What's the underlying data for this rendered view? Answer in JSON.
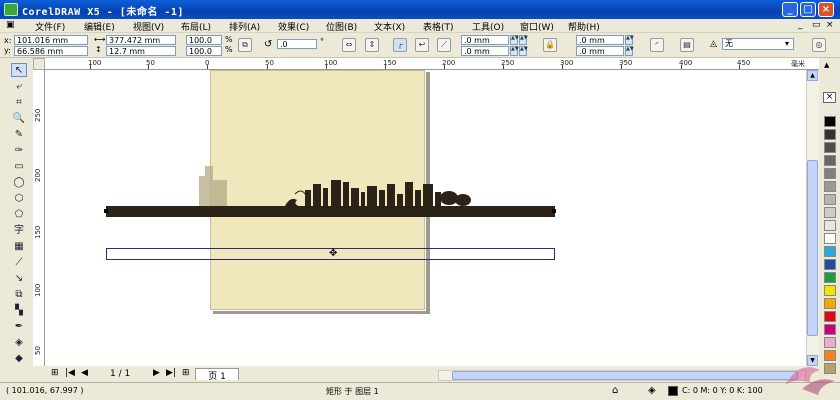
{
  "window": {
    "title": "CorelDRAW X5 - [未命名 -1]"
  },
  "menu": [
    "文件(F)",
    "编辑(E)",
    "视图(V)",
    "布局(L)",
    "排列(A)",
    "效果(C)",
    "位图(B)",
    "文本(X)",
    "表格(T)",
    "工具(O)",
    "窗口(W)",
    "帮助(H)"
  ],
  "property_bar": {
    "x_label": "x:",
    "y_label": "y:",
    "x_value": "101.016 mm",
    "y_value": "66.586 mm",
    "width_value": "377.472 mm",
    "height_value": "12.7 mm",
    "scale_x": "100.0",
    "scale_y": "100.0",
    "pct": "%",
    "rotation": ".0",
    "degree": "°",
    "corner_1": ".0 mm",
    "corner_2": ".0 mm",
    "corner_3": ".0 mm",
    "corner_4": ".0 mm",
    "outline": "无"
  },
  "rulers": {
    "h_ticks": [
      "100",
      "50",
      "0",
      "50",
      "100",
      "150",
      "200",
      "250",
      "300",
      "350",
      "400",
      "450"
    ],
    "h_unit": "毫米",
    "v_ticks": [
      "250",
      "200",
      "150",
      "100",
      "50"
    ]
  },
  "page_nav": {
    "page_count": "1 / 1",
    "page_tab": "页 1"
  },
  "status": {
    "coords": "( 101.016, 67.997 )",
    "selection": "矩形 于 图层 1",
    "fill_info": "C: 0 M: 0 Y: 0 K: 100"
  },
  "colors": {
    "accent": "#0a5fd9",
    "page_fill": "#f0e7bd",
    "bar_fill": "#2b2317",
    "selection_outline": "#2b2a80"
  },
  "palette": [
    "#000000",
    "#333333",
    "#4d4d4d",
    "#666666",
    "#808080",
    "#999999",
    "#b3b3b3",
    "#cccccc",
    "#e6e6e6",
    "#ffffff",
    "#2aa9e0",
    "#1f4e9e",
    "#1c9c3e",
    "#f2e600",
    "#f6a800",
    "#e30613",
    "#c8007e",
    "#e8b0c8",
    "#f58220",
    "#b2a36c"
  ]
}
